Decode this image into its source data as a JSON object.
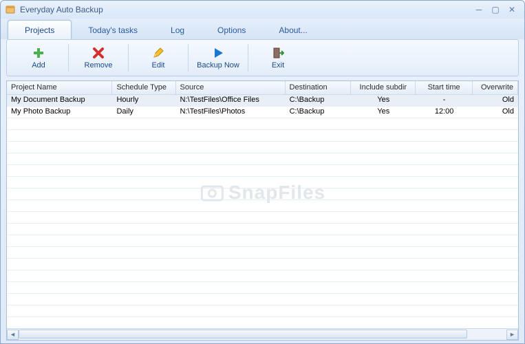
{
  "window": {
    "title": "Everyday Auto Backup"
  },
  "tabs": [
    {
      "label": "Projects",
      "active": true
    },
    {
      "label": "Today's tasks",
      "active": false
    },
    {
      "label": "Log",
      "active": false
    },
    {
      "label": "Options",
      "active": false
    },
    {
      "label": "About...",
      "active": false
    }
  ],
  "toolbar": [
    {
      "name": "add-button",
      "label": "Add",
      "icon": "plus"
    },
    {
      "name": "remove-button",
      "label": "Remove",
      "icon": "cross"
    },
    {
      "name": "edit-button",
      "label": "Edit",
      "icon": "pencil"
    },
    {
      "name": "backup-now-button",
      "label": "Backup Now",
      "icon": "play"
    },
    {
      "name": "exit-button",
      "label": "Exit",
      "icon": "door"
    }
  ],
  "columns": [
    {
      "label": "Project Name",
      "cls": "c0"
    },
    {
      "label": "Schedule Type",
      "cls": "c1"
    },
    {
      "label": "Source",
      "cls": "c2"
    },
    {
      "label": "Destination",
      "cls": "c3"
    },
    {
      "label": "Include subdir",
      "cls": "c4",
      "align": "center"
    },
    {
      "label": "Start time",
      "cls": "c5",
      "align": "center"
    },
    {
      "label": "Overwrite",
      "cls": "c6",
      "align": "right"
    }
  ],
  "rows": [
    {
      "selected": true,
      "cells": [
        "My Document Backup",
        "Hourly",
        "N:\\TestFiles\\Office Files",
        "C:\\Backup",
        "Yes",
        "-",
        "Old"
      ]
    },
    {
      "selected": false,
      "cells": [
        "My Photo Backup",
        "Daily",
        "N:\\TestFiles\\Photos",
        "C:\\Backup",
        "Yes",
        "12:00",
        "Old"
      ]
    }
  ],
  "watermark": "SnapFiles"
}
